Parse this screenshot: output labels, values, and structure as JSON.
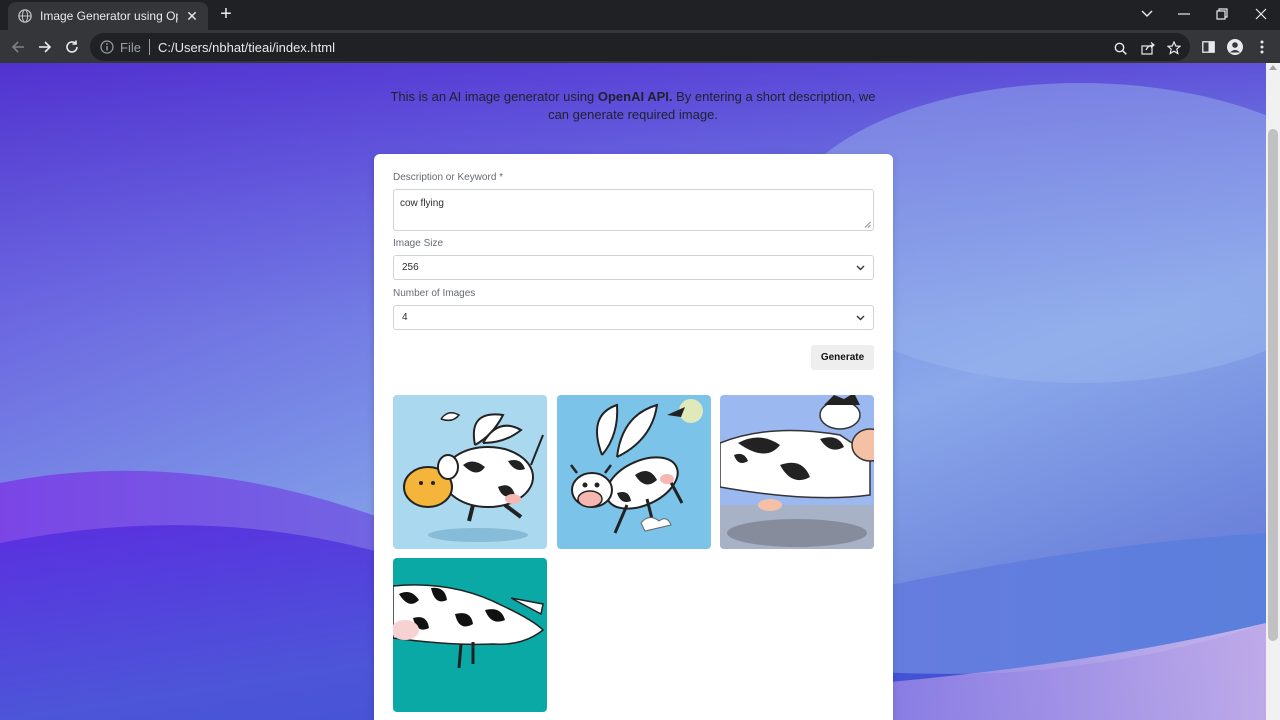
{
  "browser": {
    "tab_title": "Image Generator using OpenAI A",
    "address_scheme": "File",
    "address_url": "C:/Users/nbhat/tieai/index.html"
  },
  "page": {
    "intro_prefix": "This is an AI image generator using ",
    "intro_bold": "OpenAI API.",
    "intro_suffix": " By entering a short description, we can generate required image."
  },
  "form": {
    "description_label": "Description or Keyword *",
    "description_value": "cow flying",
    "size_label": "Image Size",
    "size_value": "256",
    "count_label": "Number of Images",
    "count_value": "4",
    "generate_label": "Generate"
  },
  "results": [
    {
      "alt": "flying cow image 1",
      "bg": "#a9d8ef"
    },
    {
      "alt": "flying cow image 2",
      "bg": "#7cc3ea"
    },
    {
      "alt": "flying cow image 3",
      "bg": "#9bb8f0"
    },
    {
      "alt": "flying cow image 4",
      "bg": "#0ba9a6"
    }
  ]
}
